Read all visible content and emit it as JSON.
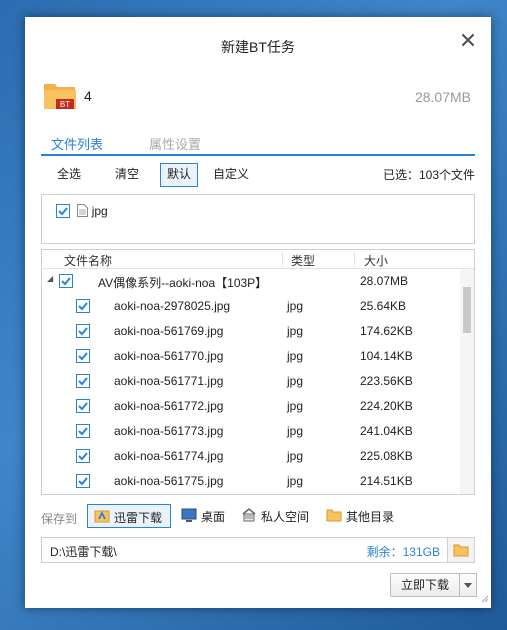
{
  "dialog": {
    "title": "新建BT任务",
    "close_icon": "close-icon"
  },
  "torrent": {
    "folder_icon_badge": "BT",
    "name": "4",
    "total_size": "28.07MB"
  },
  "tabs": [
    {
      "label": "文件列表",
      "active": true
    },
    {
      "label": "属性设置",
      "active": false
    }
  ],
  "selection": {
    "buttons": [
      {
        "label": "全选",
        "active": false
      },
      {
        "label": "清空",
        "active": false
      },
      {
        "label": "默认",
        "active": true
      },
      {
        "label": "自定义",
        "active": false
      }
    ],
    "selected_count": "已选：103个文件"
  },
  "filter": {
    "checked": true,
    "label": "jpg",
    "icon": "file-icon"
  },
  "filelist": {
    "columns": [
      "文件名称",
      "类型",
      "大小"
    ],
    "folder": {
      "name": "AV偶像系列--aoki-noa【103P】",
      "size": "28.07MB",
      "checked": true,
      "expanded": true
    },
    "files": [
      {
        "name": "aoki-noa-2978025.jpg",
        "type": "jpg",
        "size": "25.64KB",
        "checked": true
      },
      {
        "name": "aoki-noa-561769.jpg",
        "type": "jpg",
        "size": "174.62KB",
        "checked": true
      },
      {
        "name": "aoki-noa-561770.jpg",
        "type": "jpg",
        "size": "104.14KB",
        "checked": true
      },
      {
        "name": "aoki-noa-561771.jpg",
        "type": "jpg",
        "size": "223.56KB",
        "checked": true
      },
      {
        "name": "aoki-noa-561772.jpg",
        "type": "jpg",
        "size": "224.20KB",
        "checked": true
      },
      {
        "name": "aoki-noa-561773.jpg",
        "type": "jpg",
        "size": "241.04KB",
        "checked": true
      },
      {
        "name": "aoki-noa-561774.jpg",
        "type": "jpg",
        "size": "225.08KB",
        "checked": true
      },
      {
        "name": "aoki-noa-561775.jpg",
        "type": "jpg",
        "size": "214.51KB",
        "checked": true
      }
    ]
  },
  "save_to": {
    "label": "保存到",
    "locations": [
      {
        "label": "迅雷下载",
        "icon": "xunlei-folder-icon",
        "active": true
      },
      {
        "label": "桌面",
        "icon": "desktop-icon",
        "active": false
      },
      {
        "label": "私人空间",
        "icon": "private-space-icon",
        "active": false
      },
      {
        "label": "其他目录",
        "icon": "folder-icon",
        "active": false
      }
    ],
    "path": "D:\\迅雷下载\\",
    "free_space": "剩余：131GB"
  },
  "actions": {
    "start_label": "立即下载"
  },
  "colors": {
    "accent": "#2a82d7",
    "desktop_bg": "#3f86c8"
  }
}
